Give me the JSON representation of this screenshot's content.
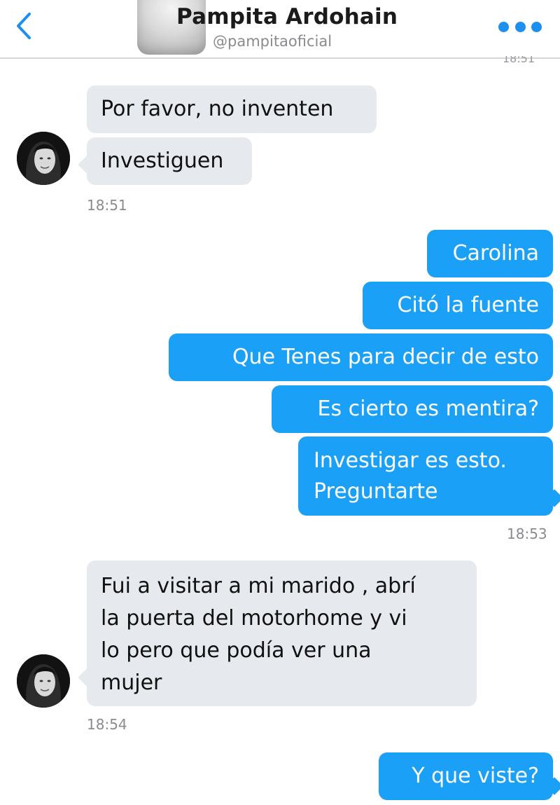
{
  "header": {
    "back_icon": "chevron-left-icon",
    "name": "Pampita Ardohain",
    "handle": "@pampitaoficial",
    "more_icon": "ellipsis-icon",
    "cut_timestamp": "18:51",
    "accent_color": "#1d8ff0"
  },
  "messages": {
    "group1": {
      "lines": [
        "Por favor, no inventen",
        "Investiguen"
      ],
      "time": "18:51"
    },
    "group2": {
      "lines": [
        "Carolina",
        "Citó la fuente",
        "Que Tenes para decir de esto",
        "Es cierto es mentira?"
      ],
      "multi": [
        "Investigar es esto.",
        "Preguntarte"
      ],
      "time": "18:53"
    },
    "group3": {
      "lines": [
        "Fui a visitar a mi marido , abrí",
        "la puerta del motorhome y vi",
        "lo pero que podía ver una",
        "mujer"
      ],
      "time": "18:54"
    },
    "group4": {
      "lines": [
        "Y que viste?"
      ]
    }
  },
  "colors": {
    "incoming_bubble": "#e6e9ee",
    "outgoing_bubble": "#1aa0f7"
  }
}
